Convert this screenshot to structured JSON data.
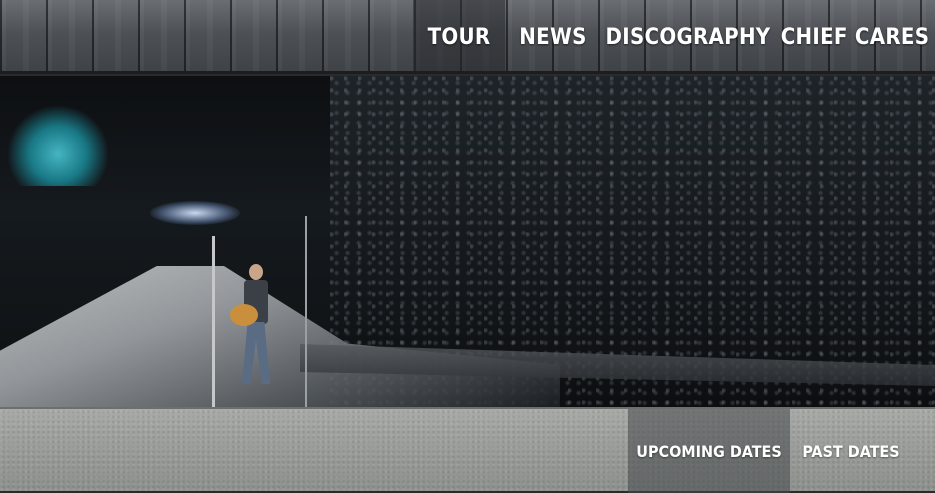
{
  "nav": {
    "items": [
      {
        "label": "TOUR"
      },
      {
        "label": "NEWS"
      },
      {
        "label": "DISCOGRAPHY"
      },
      {
        "label": "CHIEF CARES"
      }
    ]
  },
  "subnav": {
    "items": [
      {
        "label": "UPCOMING DATES"
      },
      {
        "label": "PAST DATES"
      }
    ]
  },
  "colors": {
    "nav_active_bg": "#3a3c40",
    "text": "#ffffff"
  }
}
